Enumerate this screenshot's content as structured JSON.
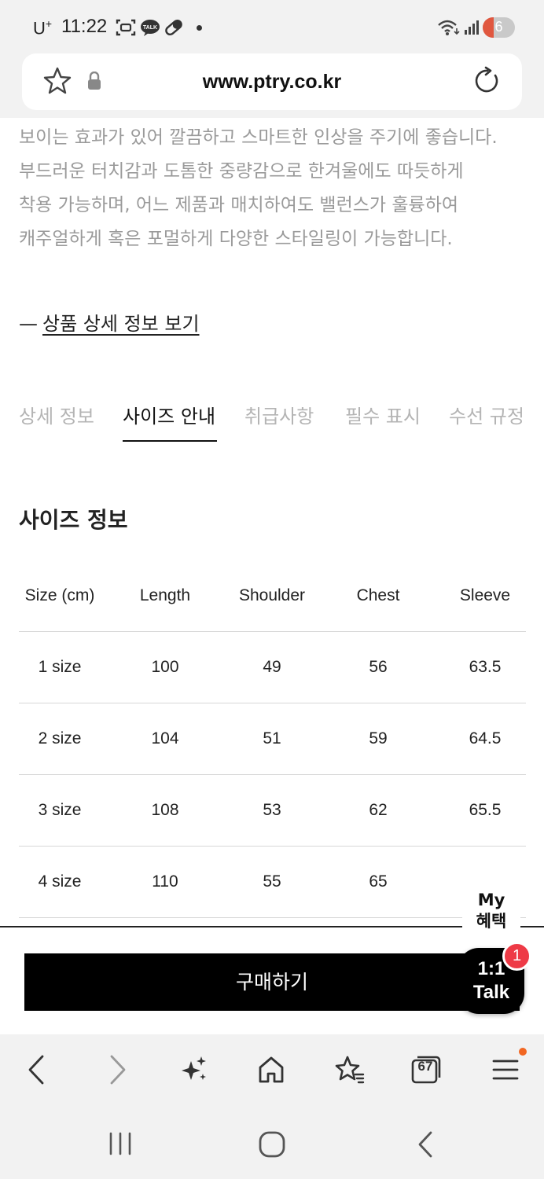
{
  "status_bar": {
    "carrier": "U",
    "carrier_sup": "+",
    "time": "11:22",
    "battery": "6"
  },
  "browser": {
    "url": "www.ptry.co.kr",
    "tabs_count": "67"
  },
  "description": {
    "lines": [
      "보이는 효과가 있어 깔끔하고 스마트한 인상을 주기에 좋습니다.",
      "부드러운 터치감과 도톰한 중량감으로 한겨울에도 따듯하게",
      "착용 가능하며, 어느 제품과 매치하여도 밸런스가 훌륭하여",
      "캐주얼하게 혹은 포멀하게 다양한 스타일링이 가능합니다."
    ],
    "detail_link_dash": "—",
    "detail_link": "상품 상세 정보 보기"
  },
  "tabs": [
    {
      "label": "상세 정보",
      "active": false
    },
    {
      "label": "사이즈 안내",
      "active": true
    },
    {
      "label": "취급사항",
      "active": false
    },
    {
      "label": "필수 표시",
      "active": false
    },
    {
      "label": "수선 규정",
      "active": false
    }
  ],
  "size_section": {
    "title": "사이즈 정보",
    "headers": [
      "Size (cm)",
      "Length",
      "Shoulder",
      "Chest",
      "Sleeve"
    ],
    "rows": [
      [
        "1 size",
        "100",
        "49",
        "56",
        "63.5"
      ],
      [
        "2 size",
        "104",
        "51",
        "59",
        "64.5"
      ],
      [
        "3 size",
        "108",
        "53",
        "62",
        "65.5"
      ],
      [
        "4 size",
        "110",
        "55",
        "65",
        ""
      ]
    ]
  },
  "purchase": {
    "buy_label": "구매하기",
    "my_benefit_line1": "My",
    "my_benefit_line2": "혜택",
    "talk_line1": "1:1",
    "talk_line2": "Talk",
    "talk_badge": "1"
  },
  "icons": {
    "back": "back-icon",
    "forward": "forward-icon",
    "ai": "sparkle-icon",
    "home": "home-icon",
    "bookmarks": "bookmarks-icon",
    "tabs": "tabs-icon",
    "menu": "menu-icon"
  },
  "colors": {
    "accent_red": "#ee3a46",
    "menu_dot": "#f26722",
    "button_bg": "#000000"
  }
}
